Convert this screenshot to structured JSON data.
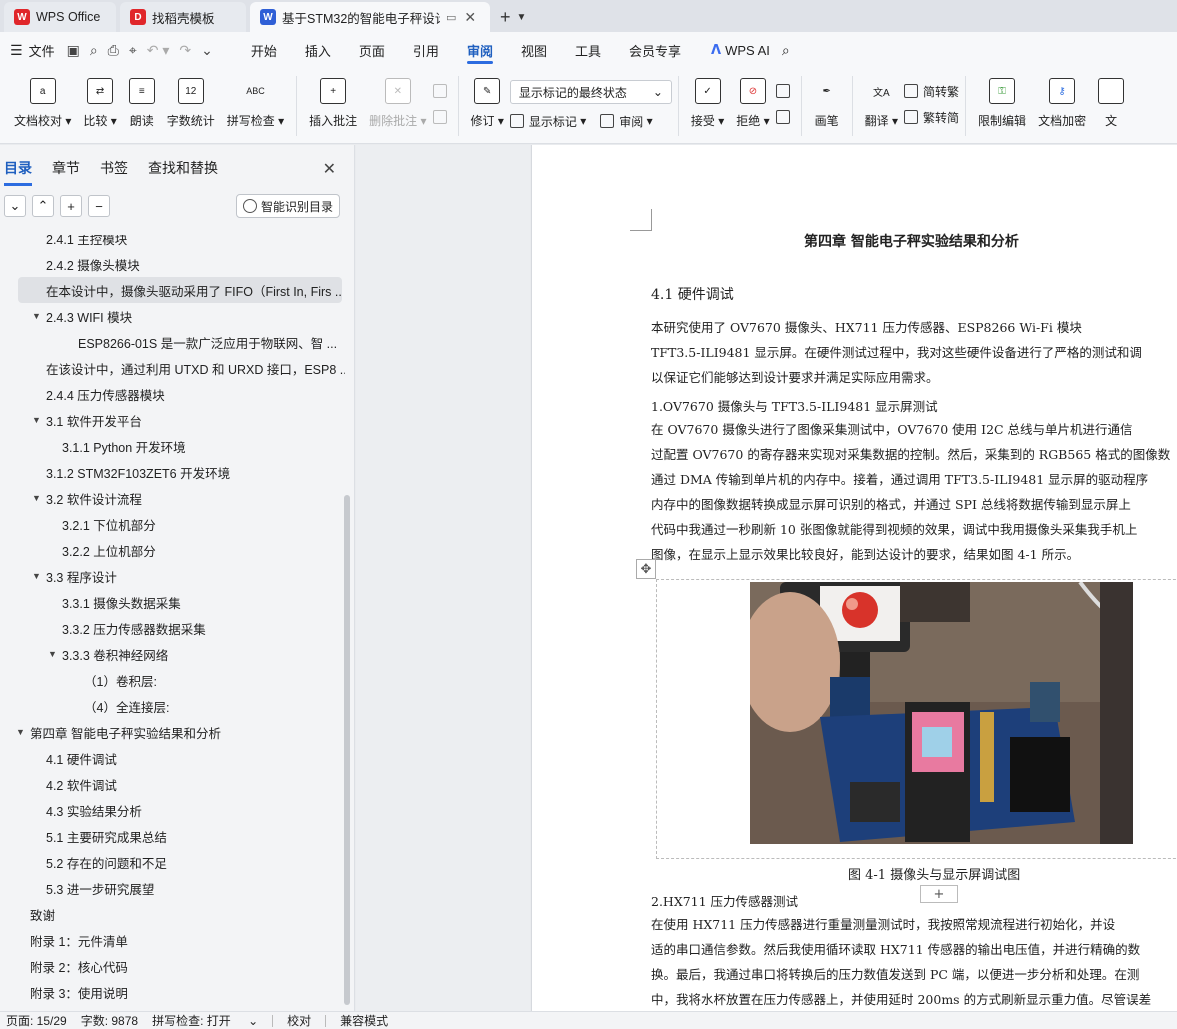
{
  "tabs": [
    {
      "label": "WPS Office",
      "logo": "W",
      "logo_color": "#e0262a",
      "active": false
    },
    {
      "label": "找稻壳模板",
      "logo": "D",
      "logo_color": "#e0262a",
      "active": false
    },
    {
      "label": "基于STM32的智能电子秤设计",
      "logo": "W",
      "logo_color": "#2f5fd6",
      "active": true
    }
  ],
  "menubar": {
    "file_label": "文件",
    "menus": [
      "开始",
      "插入",
      "页面",
      "引用",
      "审阅",
      "视图",
      "工具",
      "会员专享"
    ],
    "active_menu": "审阅",
    "ai_label": "WPS AI"
  },
  "ribbon": {
    "doc_check": "文档校对",
    "compare": "比较",
    "read_aloud": "朗读",
    "word_count": "字数统计",
    "word_count_icon": "12",
    "spell_check": "拼写检查",
    "spell_icon": "ABC",
    "insert_comment": "插入批注",
    "delete_comment": "删除批注",
    "revise": "修订",
    "markup_select": "显示标记的最终状态",
    "show_markup": "显示标记",
    "review": "审阅",
    "accept": "接受",
    "reject": "拒绝",
    "pen": "画笔",
    "translate": "翻译",
    "to_trad": "简转繁",
    "to_simp": "繁转简",
    "restrict_edit": "限制编辑",
    "doc_encrypt": "文档加密",
    "doc_more": "文"
  },
  "panel": {
    "tabs": [
      "目录",
      "章节",
      "书签",
      "查找和替换"
    ],
    "active_tab": "目录",
    "smart_toc": "智能识别目录",
    "toc": [
      {
        "text": "2.4.1 主控模块",
        "indent": 46,
        "caret": ""
      },
      {
        "text": "2.4.2  摄像头模块",
        "indent": 46,
        "caret": ""
      },
      {
        "text": "在本设计中，摄像头驱动采用了 FIFO（First In, Firs ...",
        "indent": 46,
        "caret": "",
        "hl": true
      },
      {
        "text": "2.4.3 WIFI 模块",
        "indent": 46,
        "caret": "▼"
      },
      {
        "text": "ESP8266-01S 是一款广泛应用于物联网、智 ...",
        "indent": 78,
        "caret": ""
      },
      {
        "text": "在该设计中，通过利用 UTXD 和 URXD 接口，ESP8 ...",
        "indent": 46,
        "caret": ""
      },
      {
        "text": "2.4.4 压力传感器模块",
        "indent": 46,
        "caret": ""
      },
      {
        "text": "3.1 软件开发平台",
        "indent": 46,
        "caret": "▼"
      },
      {
        "text": "3.1.1 Python 开发环境",
        "indent": 62,
        "caret": ""
      },
      {
        "text": "3.1.2 STM32F103ZET6 开发环境",
        "indent": 46,
        "caret": ""
      },
      {
        "text": "3.2  软件设计流程",
        "indent": 46,
        "caret": "▼"
      },
      {
        "text": "3.2.1 下位机部分",
        "indent": 62,
        "caret": ""
      },
      {
        "text": "3.2.2 上位机部分",
        "indent": 62,
        "caret": ""
      },
      {
        "text": "3.3 程序设计",
        "indent": 46,
        "caret": "▼"
      },
      {
        "text": "3.3.1 摄像头数据采集",
        "indent": 62,
        "caret": ""
      },
      {
        "text": "3.3.2 压力传感器数据采集",
        "indent": 62,
        "caret": ""
      },
      {
        "text": "3.3.3 卷积神经网络",
        "indent": 62,
        "caret": "▼"
      },
      {
        "text": "（1）卷积层:",
        "indent": 84,
        "caret": ""
      },
      {
        "text": "（4）全连接层:",
        "indent": 84,
        "caret": ""
      },
      {
        "text": "第四章  智能电子秤实验结果和分析",
        "indent": 30,
        "caret": "▼"
      },
      {
        "text": "4.1 硬件调试",
        "indent": 46,
        "caret": ""
      },
      {
        "text": "4.2  软件调试",
        "indent": 46,
        "caret": ""
      },
      {
        "text": "4.3  实验结果分析",
        "indent": 46,
        "caret": ""
      },
      {
        "text": "5.1  主要研究成果总结",
        "indent": 46,
        "caret": ""
      },
      {
        "text": "5.2  存在的问题和不足",
        "indent": 46,
        "caret": ""
      },
      {
        "text": "5.3  进一步研究展望",
        "indent": 46,
        "caret": ""
      },
      {
        "text": "致谢",
        "indent": 30,
        "caret": ""
      },
      {
        "text": "附录 1：元件清单",
        "indent": 30,
        "caret": ""
      },
      {
        "text": "附录 2：核心代码",
        "indent": 30,
        "caret": ""
      },
      {
        "text": "附录 3：使用说明",
        "indent": 30,
        "caret": ""
      }
    ]
  },
  "doc": {
    "chapter_title": "第四章  智能电子秤实验结果和分析",
    "section": "4.1 硬件调试",
    "p1": [
      "    本研究使用了 OV7670 摄像头、HX711 压力传感器、ESP8266 Wi-Fi 模块",
      "TFT3.5-ILI9481 显示屏。在硬件测试过程中，我对这些硬件设备进行了严格的测试和调",
      "以保证它们能够达到设计要求并满足实际应用需求。"
    ],
    "sub1": "1.OV7670 摄像头与 TFT3.5-ILI9481 显示屏测试",
    "p2": [
      "    在 OV7670 摄像头进行了图像采集测试中，OV7670 使用 I2C 总线与单片机进行通信",
      "过配置 OV7670 的寄存器来实现对采集数据的控制。然后，采集到的 RGB565 格式的图像数",
      "通过 DMA 传输到单片机的内存中。接着，通过调用 TFT3.5-ILI9481 显示屏的驱动程序",
      "内存中的图像数据转换成显示屏可识别的格式，并通过 SPI 总线将数据传输到显示屏上",
      "代码中我通过一秒刷新 10 张图像就能得到视频的效果，调试中我用摄像头采集我手机上",
      "图像，在显示上显示效果比较良好，能到达设计的要求，结果如图 4-1 所示。"
    ],
    "caption": "图 4-1 摄像头与显示屏调试图",
    "sub2": "2.HX711 压力传感器测试",
    "p3": [
      "    在使用 HX711 压力传感器进行重量测量测试时，我按照常规流程进行初始化，并设",
      "适的串口通信参数。然后我使用循环读取 HX711 传感器的输出电压值，并进行精确的数",
      "换。最后，我通过串口将转换后的压力数值发送到 PC 端，以便进一步分析和处理。在测",
      "中，我将水杯放置在压力传感器上，并使用延时 200ms 的方式刷新显示重力值。尽管误差"
    ]
  },
  "status": {
    "page": "页面: 15/29",
    "words": "字数: 9878",
    "spell": "拼写检查: 打开",
    "proof": "校对",
    "compat": "兼容模式"
  }
}
